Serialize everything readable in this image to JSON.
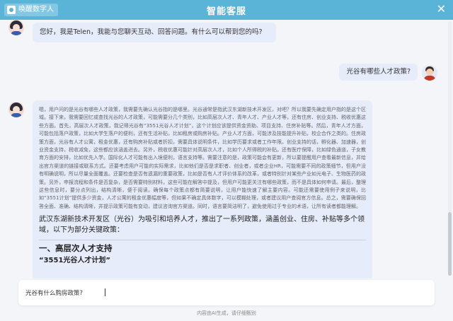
{
  "header": {
    "brand": "唤醒数字人",
    "title": "智能客服",
    "close_icon": "close-icon"
  },
  "chat": {
    "greeting": "您好，我是Telen，我能与您聊天互动、回答问题。有什么可以帮到您的吗?",
    "user_question": "光谷有哪些人才政策?",
    "answer": {
      "reasoning": "嗯，用户问的是光谷有哪些人才政策，我需要先确认光谷指的是哪里。光谷通常是指武汉东湖新技术开发区，对吧？所以我要先确定用户指的是这个区域。接下来，我需要回忆或查找光谷的人才政策，可能需要分几个类别，比如高层次人才、青年人才、产业人才等，还有住房、创业支持、税收优惠这些方面。首先，高层次人才政策，我记得光谷有“3551光谷人才计划”，这个计划应该提供资金资助、项目支持、住房补贴等。然后，青年人才方面，可能包括落户政策，比如大学生落户的便利，还有生活补贴，比如租房或购房补贴。产业人才方面，可能涉及技能提升补贴，校企合作之类的。住房政策方面，光谷有人才公寓，租金优惠，还有购房补贴或者折扣，需要具体说明条件，比如学历要求或者工作年限。创业支持的话，孵化器、加速器，创业资金支持，税收减免，这些都应该涵盖进去。另外，税收优惠可能针对高层次人才，比如个人所得税的补贴。还有医疗保障，比如绿色通道，子女教育方面的安排，比如优先入学。国际化人才可能有出入境便利，语言支持等。需要注意的是，政策可能会有更新，所以要提醒用户查看最新信息，并给出官方渠道的链接或联系方式。还要考虑用户可能的实际需求，比如他们是否是求职者、创业者，或者企业HR，可能需要不同的政策细节，但用户没有明确说明，所以尽量全面覆盖。还要检查是否有遗漏的重要政策，比如是否有人才评价体系的改革，或者特别针对某些产业如光电子、生物医药的政策。另外，申报流程和条件是否复杂，是否需要特别材料，这些可能在解答中提及，但用户可能更关注有哪些政策，而不是具体如何申请。最后，整理这些信息时，要分点列出，结构清晰，便于阅读。确保每个政策点都有简要说明，让用户能快速了解主要内容。可能还需要使用例子来说明，比如“3551计划”提供多少资金，人才公寓的租金优惠幅度等，但如果不确定具体数字，可以模糊处理，或者建议用户查阅官方信息。总之，需要确保回答全面、准确、结构清晰，并提示政策可能有变动，建议咨询官方渠道。同时，语言要简洁明了，避免使用过于专业的术语，让所有读者都能理解。",
      "summary": "武汉东湖新技术开发区（光谷）为吸引和培养人才，推出了一系列政策，涵盖创业、住房、补贴等多个领域，以下为部分关键政策：",
      "section_title": "一、高层次人才支持",
      "subsection_title": "“3551光谷人才计划”"
    }
  },
  "input": {
    "value": "光谷有什么购房政策?"
  },
  "footer": {
    "note": "内容由AI生成，请仔细甄别"
  }
}
